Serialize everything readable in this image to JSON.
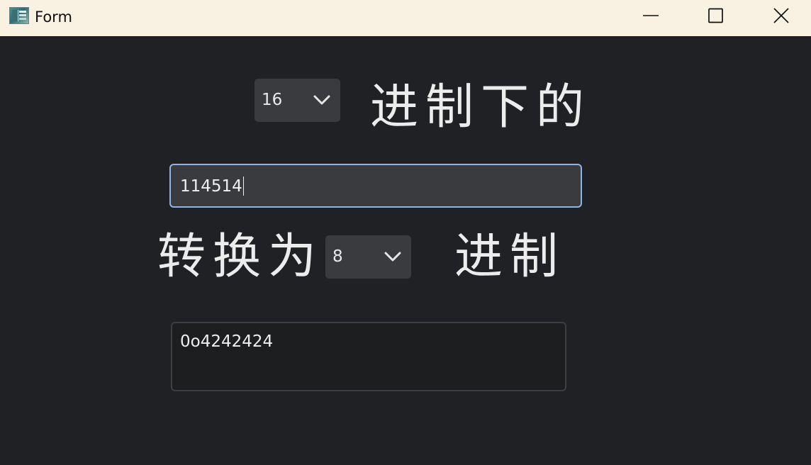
{
  "window": {
    "title": "Form",
    "icon": "app-window-icon",
    "controls": {
      "minimize_icon": "minimize-icon",
      "maximize_icon": "maximize-icon",
      "close_icon": "close-icon"
    }
  },
  "colors": {
    "titlebar": "#f9f1e2",
    "background": "#202125",
    "control": "#3a3b3e",
    "focus_border": "#8fb3e8",
    "text": "#ececec"
  },
  "form": {
    "source_base": {
      "selected": "16",
      "icon": "chevron-down-icon"
    },
    "source_suffix": "进制下的",
    "input_value": "114514",
    "convert_prefix": "转换为",
    "target_base": {
      "selected": "8",
      "icon": "chevron-down-icon"
    },
    "target_suffix": "进制",
    "output_value": "0o4242424"
  }
}
